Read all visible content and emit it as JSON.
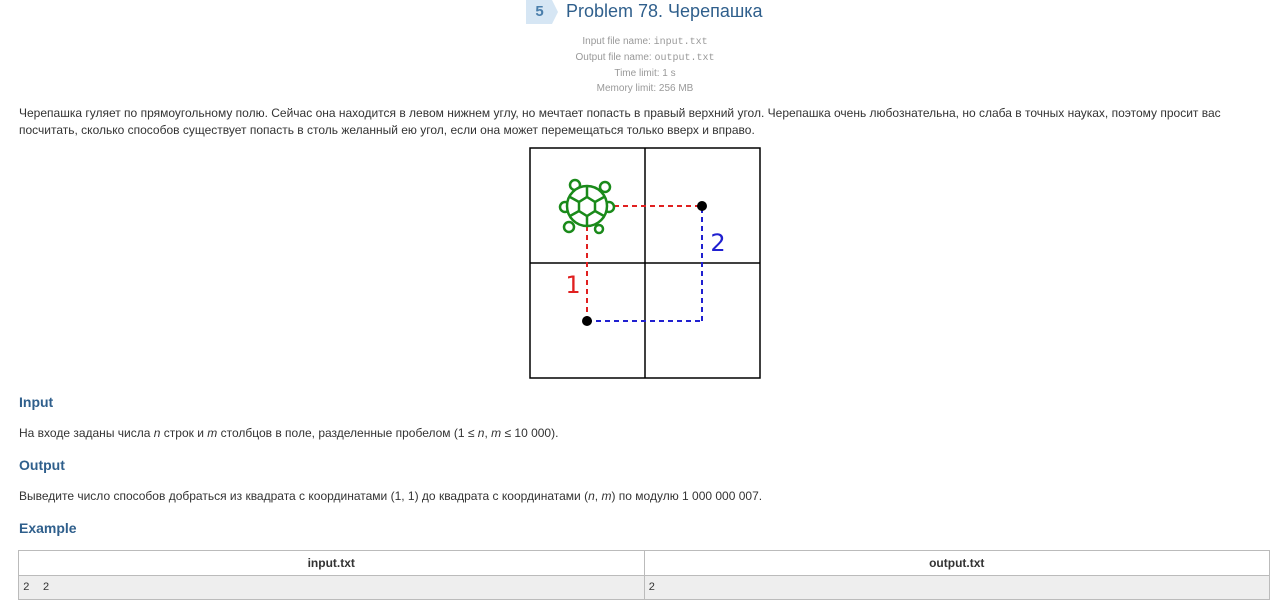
{
  "header": {
    "problem_number": "5",
    "problem_title": "Problem 78. Черепашка"
  },
  "limits": {
    "input_label": "Input file name:",
    "input_value": "input.txt",
    "output_label": "Output file name:",
    "output_value": "output.txt",
    "time_limit": "Time limit: 1 s",
    "memory_limit": "Memory limit: 256 MB"
  },
  "statement": "Черепашка гуляет по прямоугольному полю. Сейчас она находится в левом нижнем углу, но мечтает попасть в правый верхний угол. Черепашка очень любознательна, но слаба в точных науках, поэтому просит вас посчитать, сколько способов существует попасть в столь желанный ею угол, если она может перемещаться только вверх и вправо.",
  "figure": {
    "path1_label": "1",
    "path2_label": "2",
    "path1_color": "#e02020",
    "path2_color": "#2020d0",
    "turtle_color": "#1a8a1a",
    "grid_rows": 2,
    "grid_cols": 2
  },
  "input_section": {
    "heading": "Input",
    "text_before_n": "На входе заданы числа ",
    "n": "n",
    "text_mid": " строк и ",
    "m": "m",
    "text_after_m": " столбцов в поле, разделенные пробелом (1 ≤ ",
    "n2": "n",
    "comma": ", ",
    "m2": "m",
    "text_end": " ≤ 10 000)."
  },
  "output_section": {
    "heading": "Output",
    "text_before": "Выведите число способов добраться из квадрата с координатами (1, 1) до квадрата с координатами (",
    "n": "n",
    "comma": ", ",
    "m": "m",
    "text_end": ") по модулю 1 000 000 007."
  },
  "example_section": {
    "heading": "Example",
    "columns": [
      "input.txt",
      "output.txt"
    ],
    "rows": [
      [
        "2  2",
        "2"
      ]
    ]
  },
  "colors": {
    "heading": "#2f5f8c",
    "badge_bg": "#d6e6f4",
    "muted": "#999999"
  }
}
